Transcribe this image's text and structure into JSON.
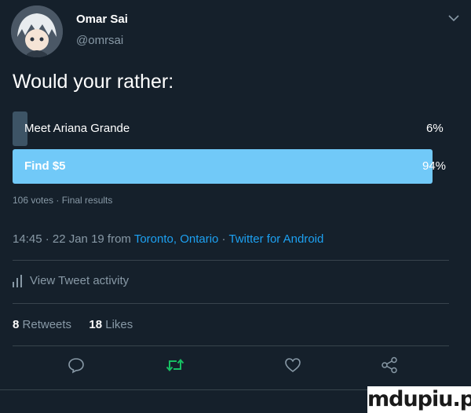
{
  "tweet": {
    "author_name": "Omar Sai",
    "author_handle": "@omrsai",
    "question": "Would your rather:"
  },
  "poll": {
    "options": [
      {
        "label": "Meet Ariana Grande",
        "percent_text": "6%",
        "percent": 6
      },
      {
        "label": "Find $5",
        "percent_text": "94%",
        "percent": 94
      }
    ],
    "summary": "106 votes · Final results"
  },
  "timestamp": {
    "time_date": "14:45 · 22 Jan 19 from ",
    "location": "Toronto, Ontario",
    "separator": " · ",
    "source": "Twitter for Android"
  },
  "activity": {
    "label": "View Tweet activity"
  },
  "stats": {
    "retweets_count": "8",
    "retweets_label": "Retweets",
    "likes_count": "18",
    "likes_label": "Likes"
  },
  "actions": {
    "reply_icon": "reply-icon",
    "retweet_icon": "retweet-icon",
    "like_icon": "heart-icon",
    "share_icon": "share-icon"
  },
  "watermark": "mdupiu.pl",
  "colors": {
    "background": "#15202b",
    "accent": "#1da1f2",
    "poll_winner": "#71c9f8",
    "poll_loser": "#3d5466",
    "muted": "#8899a6",
    "retweet": "#17bf63"
  }
}
